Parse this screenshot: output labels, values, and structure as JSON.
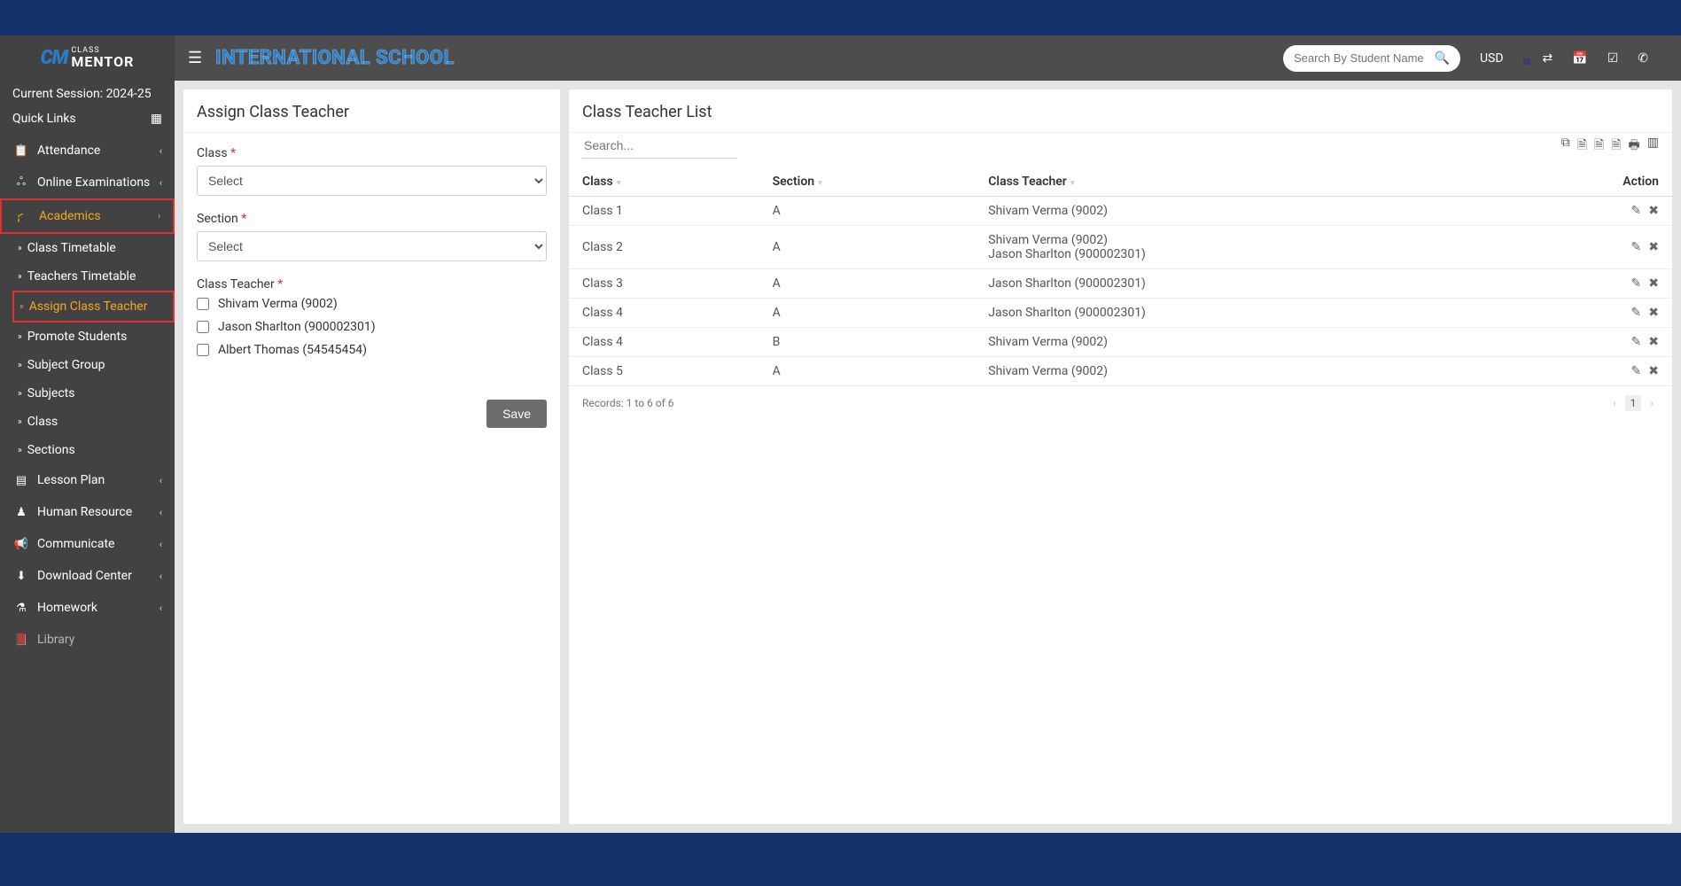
{
  "logo": {
    "brand_small": "CLASS",
    "brand_big": "MENTOR"
  },
  "session_label": "Current Session: 2024-25",
  "quick_links_label": "Quick Links",
  "header": {
    "school_name": "INTERNATIONAL SCHOOL",
    "search_placeholder": "Search By Student Name",
    "currency": "USD"
  },
  "sidebar": {
    "attendance": "Attendance",
    "online_exams": "Online Examinations",
    "academics": "Academics",
    "academics_sub": {
      "class_timetable": "Class Timetable",
      "teachers_timetable": "Teachers Timetable",
      "assign_class_teacher": "Assign Class Teacher",
      "promote_students": "Promote Students",
      "subject_group": "Subject Group",
      "subjects": "Subjects",
      "class": "Class",
      "sections": "Sections"
    },
    "lesson_plan": "Lesson Plan",
    "human_resource": "Human Resource",
    "communicate": "Communicate",
    "download_center": "Download Center",
    "homework": "Homework",
    "library": "Library"
  },
  "form": {
    "title": "Assign Class Teacher",
    "class_label": "Class",
    "section_label": "Section",
    "teacher_label": "Class Teacher",
    "select_option": "Select",
    "teachers": [
      "Shivam Verma (9002)",
      "Jason Sharlton (900002301)",
      "Albert Thomas (54545454)"
    ],
    "save_btn": "Save"
  },
  "list": {
    "title": "Class Teacher List",
    "search_placeholder": "Search...",
    "columns": {
      "class": "Class",
      "section": "Section",
      "teacher": "Class Teacher",
      "action": "Action"
    },
    "rows": [
      {
        "class": "Class 1",
        "section": "A",
        "teacher": "Shivam Verma (9002)"
      },
      {
        "class": "Class 2",
        "section": "A",
        "teacher": "Shivam Verma (9002)\nJason Sharlton (900002301)"
      },
      {
        "class": "Class 3",
        "section": "A",
        "teacher": "Jason Sharlton (900002301)"
      },
      {
        "class": "Class 4",
        "section": "A",
        "teacher": "Jason Sharlton (900002301)"
      },
      {
        "class": "Class 4",
        "section": "B",
        "teacher": "Shivam Verma (9002)"
      },
      {
        "class": "Class 5",
        "section": "A",
        "teacher": "Shivam Verma (9002)"
      }
    ],
    "records_text": "Records: 1 to 6 of 6",
    "page_num": "1"
  }
}
